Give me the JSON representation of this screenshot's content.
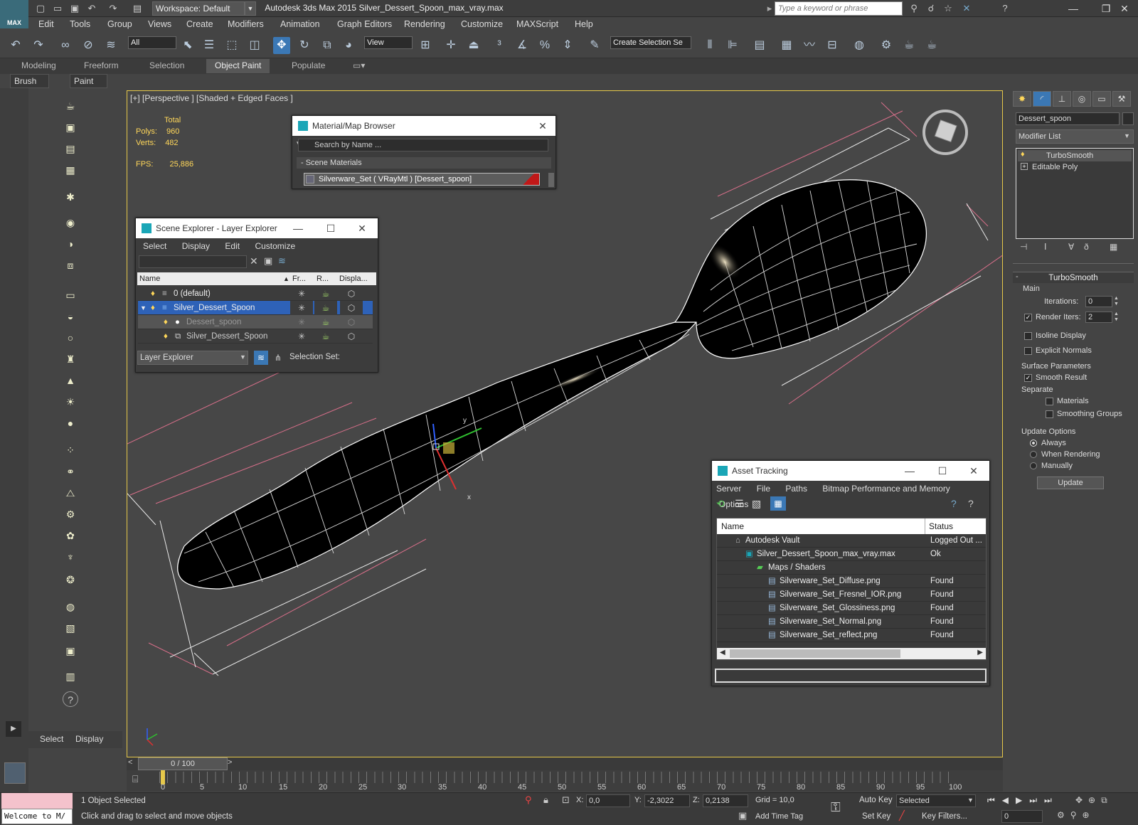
{
  "app": {
    "title": "Autodesk 3ds Max  2015     Silver_Dessert_Spoon_max_vray.max",
    "workspace": "Workspace: Default",
    "search_placeholder": "Type a keyword or phrase",
    "logo_text": "MAX"
  },
  "menu": [
    "Edit",
    "Tools",
    "Group",
    "Views",
    "Create",
    "Modifiers",
    "Animation",
    "Graph Editors",
    "Rendering",
    "Customize",
    "MAXScript",
    "Help"
  ],
  "toolbar": {
    "filter_select": "All",
    "coord_select": "View",
    "selection_set": "Create Selection Se"
  },
  "ribbon": {
    "tabs": [
      "Modeling",
      "Freeform",
      "Selection",
      "Object Paint",
      "Populate"
    ],
    "active_tab": "Object Paint",
    "sub_buttons": [
      "Brush Settings",
      "Paint Objects"
    ]
  },
  "viewport": {
    "label": "[+] [Perspective ] [Shaded + Edged Faces ]",
    "stats_header": "Total",
    "polys_label": "Polys:",
    "polys": "960",
    "verts_label": "Verts:",
    "verts": "482",
    "fps_label": "FPS:",
    "fps": "25,886",
    "gizmo_x": "x",
    "gizmo_y": "y"
  },
  "material_browser": {
    "title": "Material/Map Browser",
    "search_placeholder": "Search by Name ...",
    "group": "- Scene Materials",
    "item": "Silverware_Set  ( VRayMtl )  [Dessert_spoon]"
  },
  "scene_explorer": {
    "title": "Scene Explorer - Layer Explorer",
    "menu": [
      "Select",
      "Display",
      "Edit",
      "Customize"
    ],
    "columns": [
      "Name",
      "Fr...",
      "R...",
      "Displa..."
    ],
    "rows": [
      {
        "name": "0 (default)"
      },
      {
        "name": "Silver_Dessert_Spoon"
      },
      {
        "name": "Dessert_spoon"
      },
      {
        "name": "Silver_Dessert_Spoon"
      }
    ],
    "footer_select": "Layer Explorer",
    "selection_set_label": "Selection Set:"
  },
  "command_panel": {
    "object_name": "Dessert_spoon",
    "modifier_list": "Modifier List",
    "stack": [
      "TurboSmooth",
      "Editable Poly"
    ],
    "rollout_title": "TurboSmooth",
    "main_label": "Main",
    "iterations_label": "Iterations:",
    "iterations": "0",
    "render_iters_label": "Render Iters:",
    "render_iters": "2",
    "isoline_label": "Isoline Display",
    "explicit_normals_label": "Explicit Normals",
    "surface_params_label": "Surface Parameters",
    "smooth_result_label": "Smooth Result",
    "separate_label": "Separate",
    "materials_label": "Materials",
    "smoothing_groups_label": "Smoothing Groups",
    "update_options_label": "Update Options",
    "always_label": "Always",
    "when_rendering_label": "When Rendering",
    "manually_label": "Manually",
    "update_button": "Update"
  },
  "asset_tracking": {
    "title": "Asset Tracking",
    "menu": [
      "Server",
      "File",
      "Paths",
      "Bitmap Performance and Memory",
      "Options"
    ],
    "columns": [
      "Name",
      "Status"
    ],
    "rows": [
      {
        "name": "Autodesk Vault",
        "status": "Logged Out ..."
      },
      {
        "name": "Silver_Dessert_Spoon_max_vray.max",
        "status": "Ok"
      },
      {
        "name": "Maps / Shaders",
        "status": ""
      },
      {
        "name": "Silverware_Set_Diffuse.png",
        "status": "Found"
      },
      {
        "name": "Silverware_Set_Fresnel_IOR.png",
        "status": "Found"
      },
      {
        "name": "Silverware_Set_Glossiness.png",
        "status": "Found"
      },
      {
        "name": "Silverware_Set_Normal.png",
        "status": "Found"
      },
      {
        "name": "Silverware_Set_reflect.png",
        "status": "Found"
      }
    ]
  },
  "left_panel": {
    "tabs": [
      "Select",
      "Display"
    ]
  },
  "timeline": {
    "frame": "0 / 100",
    "ticks": [
      "0",
      "5",
      "10",
      "15",
      "20",
      "25",
      "30",
      "35",
      "40",
      "45",
      "50",
      "55",
      "60",
      "65",
      "70",
      "75",
      "80",
      "85",
      "90",
      "95",
      "100"
    ]
  },
  "status": {
    "maxscript": "Welcome to M/",
    "selected": "1 Object Selected",
    "prompt": "Click and drag to select and move objects",
    "x_label": "X:",
    "x": "0,0",
    "y_label": "Y:",
    "y": "-2,3022",
    "z_label": "Z:",
    "z": "0,2138",
    "grid": "Grid = 10,0",
    "add_time_tag": "Add Time Tag",
    "auto_key": "Auto Key",
    "set_key": "Set Key",
    "key_mode": "Selected",
    "key_filters": "Key Filters...",
    "frame_field": "0"
  }
}
